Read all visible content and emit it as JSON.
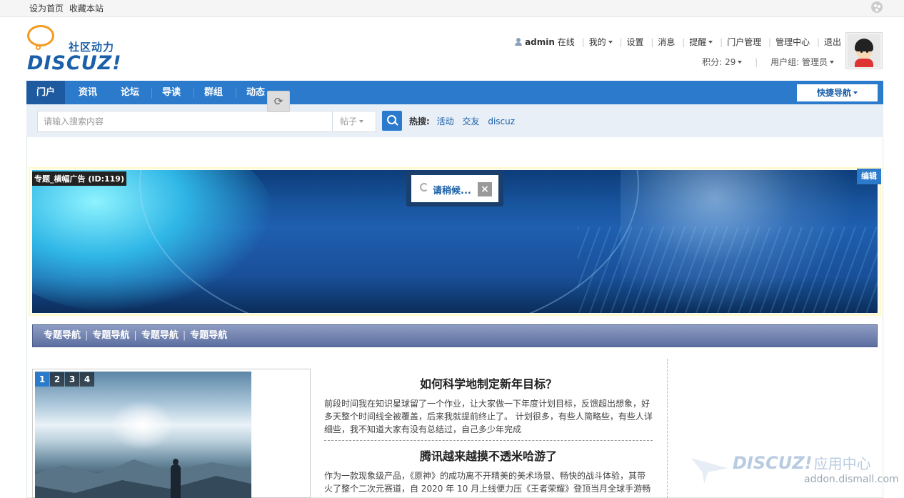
{
  "topbar": {
    "set_home": "设为首页",
    "bookmark": "收藏本站",
    "palette_icon": "palette-icon"
  },
  "logo": {
    "cn": "社区动力",
    "en": "DISCUZ!"
  },
  "user": {
    "name": "admin",
    "status": "在线",
    "mine": "我的",
    "settings": "设置",
    "messages": "消息",
    "reminders": "提醒",
    "portal_admin": "门户管理",
    "admin_center": "管理中心",
    "logout": "退出",
    "points": "积分: 29",
    "group": "用户组: 管理员"
  },
  "nav": {
    "items": [
      "门户",
      "资讯",
      "论坛",
      "导读",
      "群组",
      "动态"
    ],
    "active": "门户",
    "quick_nav": "快捷导航"
  },
  "search": {
    "placeholder": "请输入搜索内容",
    "type": "帖子",
    "hot_label": "热搜:",
    "hot_terms": [
      "活动",
      "交友",
      "discuz"
    ]
  },
  "banner": {
    "label": "专题_横幅广告 (ID:119)",
    "edit": "编辑"
  },
  "dialog": {
    "text": "请稍候...",
    "close": "×"
  },
  "special_nav": [
    "专题导航",
    "专题导航",
    "专题导航",
    "专题导航"
  ],
  "slider": {
    "numbers": [
      "1",
      "2",
      "3",
      "4"
    ],
    "active": "1"
  },
  "articles": [
    {
      "title": "如何科学地制定新年目标？",
      "desc": "前段时间我在知识星球留了一个作业，让大家做一下年度计划目标，反馈超出想象，好多天整个时间线全被覆盖，后来我就提前终止了。 计划很多，有些人简略些，有些人详细些，我不知道大家有没有总结过，自己多少年完成"
    },
    {
      "title": "腾讯越来越摸不透米哈游了",
      "desc": "作为一款现象级产品，《原神》的成功离不开精美的美术场景、畅快的战斗体验，其带火了整个二次元赛道，自 2020 年 10 月上线便力压《王者荣耀》登顶当月全球手游畅"
    }
  ],
  "watermark": {
    "brand": "DISCUZ!",
    "cn": "应用中心",
    "url": "addon.dismall.com"
  }
}
